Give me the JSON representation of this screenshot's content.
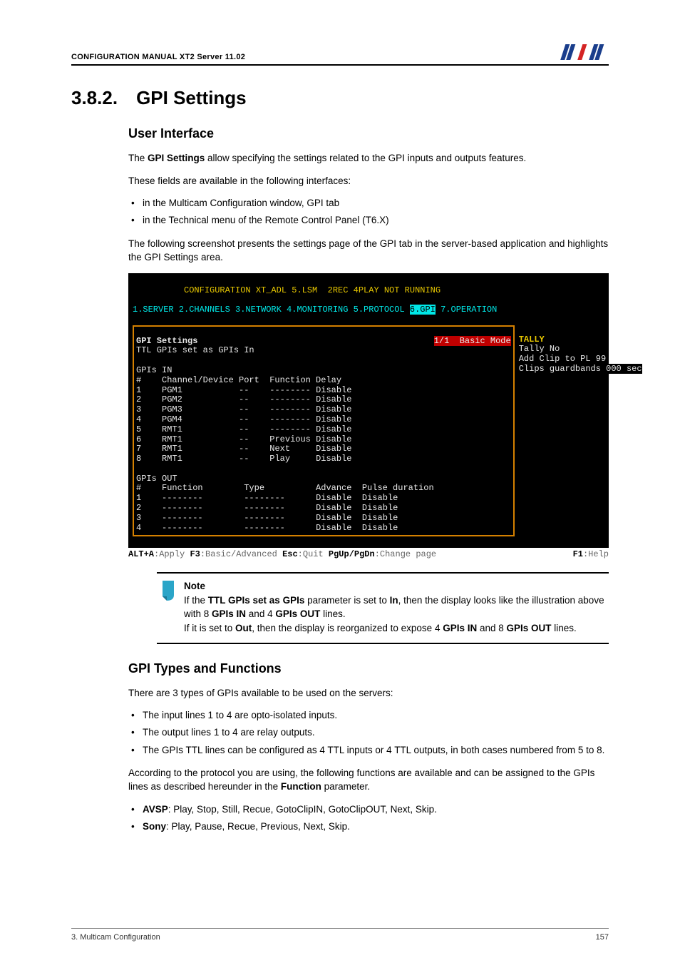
{
  "header": {
    "left": "CONFIGURATION MANUAL XT2 Server 11.02",
    "logo_alt": "EVS"
  },
  "section": {
    "number": "3.8.2.",
    "title": "GPI Settings"
  },
  "ui": {
    "heading": "User Interface",
    "p1_a": "The ",
    "p1_b": "GPI Settings",
    "p1_c": " allow specifying the settings related to the GPI inputs and outputs features.",
    "p2": "These fields are available in the following interfaces:",
    "bullets": [
      "in the Multicam Configuration window, GPI tab",
      "in the Technical menu of the Remote Control Panel (T6.X)"
    ],
    "p3": "The following screenshot presents the settings page of the GPI tab in the server-based application and highlights the GPI Settings area."
  },
  "terminal": {
    "title_line": "          CONFIGURATION XT_ADL 5.LSM  2REC 4PLAY NOT RUNNING",
    "menu": {
      "items": "1.SERVER 2.CHANNELS 3.NETWORK 4.MONITORING 5.PROTOCOL ",
      "active": "6.GPI",
      "rest": " 7.OPERATION"
    },
    "mode_line_right": "1/1  Basic Mode",
    "left_panel": {
      "header": "GPI Settings",
      "ttl_line": "TTL GPIs set as GPIs In",
      "in_header": "GPIs IN",
      "in_cols": "#    Channel/Device Port  Function Delay",
      "in_rows": [
        {
          "n": "1",
          "dev": "PGM1",
          "port": "--",
          "func": "--------",
          "delay": "Disable"
        },
        {
          "n": "2",
          "dev": "PGM2",
          "port": "--",
          "func": "--------",
          "delay": "Disable"
        },
        {
          "n": "3",
          "dev": "PGM3",
          "port": "--",
          "func": "--------",
          "delay": "Disable"
        },
        {
          "n": "4",
          "dev": "PGM4",
          "port": "--",
          "func": "--------",
          "delay": "Disable"
        },
        {
          "n": "5",
          "dev": "RMT1",
          "port": "--",
          "func": "--------",
          "delay": "Disable"
        },
        {
          "n": "6",
          "dev": "RMT1",
          "port": "--",
          "func": "Previous",
          "delay": "Disable"
        },
        {
          "n": "7",
          "dev": "RMT1",
          "port": "--",
          "func": "Next    ",
          "delay": "Disable"
        },
        {
          "n": "8",
          "dev": "RMT1",
          "port": "--",
          "func": "Play    ",
          "delay": "Disable"
        }
      ],
      "out_header": "GPIs OUT",
      "out_cols": "#    Function        Type          Advance  Pulse duration",
      "out_rows": [
        {
          "n": "1",
          "func": "--------",
          "type": "--------",
          "adv": "Disable",
          "pd": "Disable"
        },
        {
          "n": "2",
          "func": "--------",
          "type": "--------",
          "adv": "Disable",
          "pd": "Disable"
        },
        {
          "n": "3",
          "func": "--------",
          "type": "--------",
          "adv": "Disable",
          "pd": "Disable"
        },
        {
          "n": "4",
          "func": "--------",
          "type": "--------",
          "adv": "Disable",
          "pd": "Disable"
        }
      ]
    },
    "right_panel": {
      "tally_header": "TALLY",
      "tally_value": "Tally No",
      "add_clip": "Add Clip to PL 99",
      "guardbands": "Clips guardbands 000 sec"
    },
    "statusbar": {
      "alt_a": "ALT+A",
      "alt_a_t": ":Apply ",
      "f3": "F3",
      "f3_t": ":Basic/Advanced ",
      "esc": "Esc",
      "esc_t": ":Quit ",
      "pg": "PgUp/PgDn",
      "pg_t": ":Change page",
      "f1": "F1",
      "f1_t": ":Help"
    }
  },
  "note": {
    "title": "Note",
    "l1_a": "If the ",
    "l1_b": "TTL GPIs set as GPIs",
    "l1_c": " parameter is set to ",
    "l1_d": "In",
    "l1_e": ", then the display looks like the illustration above with 8 ",
    "l1_f": "GPIs IN",
    "l1_g": " and 4 ",
    "l1_h": "GPIs OUT",
    "l1_i": " lines.",
    "l2_a": "If it is set to ",
    "l2_b": "Out",
    "l2_c": ", then the display is reorganized to expose 4 ",
    "l2_d": "GPIs IN",
    "l2_e": " and 8 ",
    "l2_f": "GPIs OUT",
    "l2_g": " lines."
  },
  "types": {
    "heading": "GPI Types and Functions",
    "p1": "There are 3 types of GPIs available to be used on the servers:",
    "bullets": [
      "The input lines 1 to 4 are opto-isolated inputs.",
      "The output lines 1 to 4 are relay outputs.",
      "The GPIs TTL lines can be configured as 4 TTL inputs or 4 TTL outputs, in both cases numbered from 5 to 8."
    ],
    "p2_a": "According to the protocol you are using, the following functions are available and can be assigned to the GPIs lines as described hereunder in the ",
    "p2_b": "Function",
    "p2_c": " parameter.",
    "proto": [
      {
        "name": "AVSP",
        "funcs": ": Play, Stop, Still, Recue, GotoClipIN, GotoClipOUT, Next, Skip."
      },
      {
        "name": "Sony",
        "funcs": ": Play, Pause, Recue, Previous, Next, Skip."
      }
    ]
  },
  "footer": {
    "left": "3. Multicam Configuration",
    "right": "157"
  }
}
